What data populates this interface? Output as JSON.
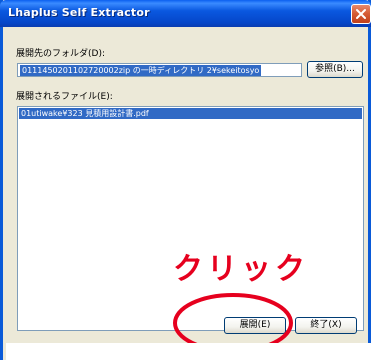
{
  "window": {
    "title": "Lhaplus Self Extractor"
  },
  "destination": {
    "label": "展開先のフォルダ(D):",
    "path": "0111450201102720002zip の一時ディレクトリ 2¥sekeitosyo",
    "browse_label": "参照(B)..."
  },
  "files": {
    "label": "展開されるファイル(E):",
    "items": [
      "01utiwake¥323 見積用設計書.pdf"
    ]
  },
  "callout": {
    "text": "クリック",
    "color": "#e6001e"
  },
  "buttons": {
    "expand_label": "展開(E)",
    "quit_label": "終了(X)"
  },
  "colors": {
    "titlebar": "#0a58e0",
    "selection": "#316ac5",
    "window_bg": "#ece9d8",
    "close": "#d45a33"
  }
}
